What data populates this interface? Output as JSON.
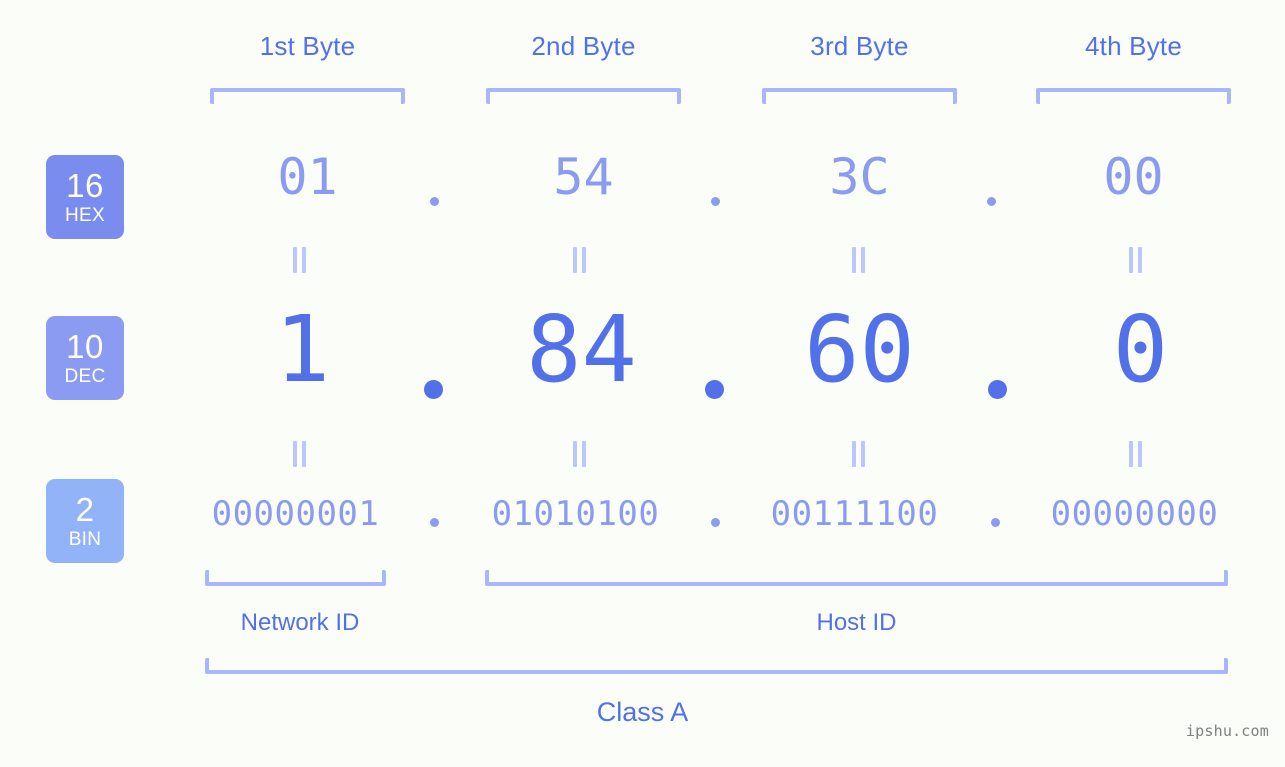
{
  "page": {
    "background": "#fbfdf8",
    "accent": "#5271e8",
    "accent_light": "#8b9cf0",
    "bracket_color": "#aab6fa",
    "watermark": "ipshu.com"
  },
  "byte_headers": [
    {
      "label": "1st Byte"
    },
    {
      "label": "2nd Byte"
    },
    {
      "label": "3rd Byte"
    },
    {
      "label": "4th Byte"
    }
  ],
  "bases": [
    {
      "number": "16",
      "name": "HEX",
      "color": "#7a8ced"
    },
    {
      "number": "10",
      "name": "DEC",
      "color": "#8c9bf2"
    },
    {
      "number": "2",
      "name": "BIN",
      "color": "#92b3f7"
    }
  ],
  "rows": {
    "hex": {
      "values": [
        "01",
        "54",
        "3C",
        "00"
      ],
      "separator": "."
    },
    "dec": {
      "values": [
        "1",
        "84",
        "60",
        "0"
      ],
      "separator": "."
    },
    "bin": {
      "values": [
        "00000001",
        "01010100",
        "00111100",
        "00000000"
      ],
      "separator": "."
    }
  },
  "equals_symbol": "=",
  "segments": [
    {
      "label": "Network ID"
    },
    {
      "label": "Host ID"
    }
  ],
  "class": {
    "label": "Class A"
  }
}
